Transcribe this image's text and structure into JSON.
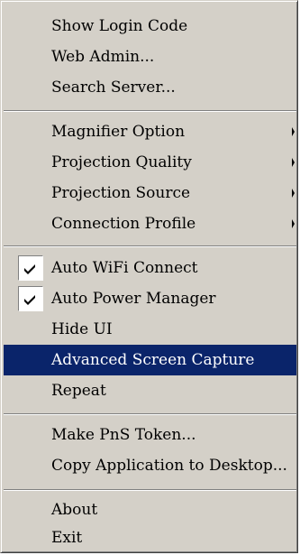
{
  "menu": {
    "groups": [
      {
        "items": [
          {
            "label": "Show Login Code"
          },
          {
            "label": "Web Admin..."
          },
          {
            "label": "Search Server..."
          }
        ]
      },
      {
        "items": [
          {
            "label": "Magnifier Option",
            "submenu": true
          },
          {
            "label": "Projection Quality",
            "submenu": true
          },
          {
            "label": "Projection Source",
            "submenu": true
          },
          {
            "label": "Connection Profile",
            "submenu": true
          }
        ]
      },
      {
        "items": [
          {
            "label": "Auto WiFi Connect",
            "checked": true
          },
          {
            "label": "Auto Power Manager",
            "checked": true
          },
          {
            "label": "Hide UI"
          },
          {
            "label": "Advanced Screen Capture",
            "highlighted": true
          },
          {
            "label": "Repeat"
          }
        ]
      },
      {
        "items": [
          {
            "label": "Make PnS Token..."
          },
          {
            "label": "Copy Application to Desktop..."
          }
        ]
      },
      {
        "items": [
          {
            "label": "About"
          },
          {
            "label": "Exit"
          }
        ]
      }
    ]
  },
  "colors": {
    "menu_background": "#d4d0c8",
    "highlight": "#0a246a",
    "highlight_text": "#ffffff"
  }
}
